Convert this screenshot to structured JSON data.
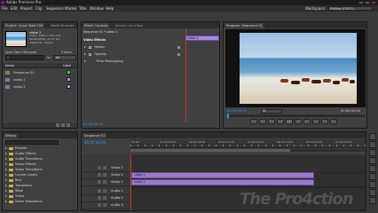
{
  "window": {
    "title": "Adobe Premiere Pro"
  },
  "menu": [
    "File",
    "Edit",
    "Project",
    "Clip",
    "Sequence",
    "Marker",
    "Title",
    "Window",
    "Help"
  ],
  "workspace": {
    "label": "Workspace:",
    "value": "Editing (CS5.5)"
  },
  "project": {
    "tabs": [
      "Project: Quick Take CS6",
      "Media Browser",
      "Info",
      "Effects"
    ],
    "clip_name": "video 2",
    "clip_info": [
      "Video, 1280 x 720 (1.0)",
      "00:00:08:05, 29.97 fps",
      "44100 Hz - Stereo"
    ],
    "project_name": "Quick Take CS6.prproj",
    "items_count": "3 Items",
    "search_placeholder": "",
    "in_label": "In:",
    "in_value": "All",
    "col_name": "Name",
    "col_label": "Label",
    "items": [
      {
        "name": "Sequence 01",
        "color": "#3ec94a"
      },
      {
        "name": "video 1",
        "color": "#a38bd6"
      },
      {
        "name": "video 2",
        "color": "#a38bd6"
      }
    ]
  },
  "effect_controls": {
    "tabs": [
      "Effect Controls",
      "Source: (no clips)"
    ],
    "header": "Sequence 01 * video 1",
    "clip_label": "video 1",
    "section": "Video Effects",
    "effects": [
      "Motion",
      "Opacity",
      "Time Remapping"
    ],
    "timecode": "00:00:00:00"
  },
  "program": {
    "tab": "Program: Sequence 01",
    "timecode_left": "00:00:00:00",
    "timecode_right": "00:00:04:00",
    "fit": "Fit",
    "horses": 8
  },
  "effects": {
    "tabs": [
      "Effects",
      "History"
    ],
    "folders": [
      "Presets",
      "Audio Effects",
      "Audio Transitions",
      "Video Effects",
      "Video Transitions",
      "Lumetri Looks",
      "Blur",
      "Transitions",
      "Wipe",
      "Video",
      "Video Transitions"
    ]
  },
  "timeline": {
    "tab": "Sequence 01",
    "timecode": "00:00:00:00",
    "ruler": [
      "00:00",
      "00:00:04:00",
      "00:00:08:00",
      "00:00:12:00",
      "00:00:16:00",
      "00:00:20:00",
      "00:00:24:00",
      "00:00:28:00"
    ],
    "tracks": [
      {
        "name": "Video 3"
      },
      {
        "name": "Video 2"
      },
      {
        "name": "Video 1"
      },
      {
        "name": "Audio 1"
      },
      {
        "name": "Audio 2"
      },
      {
        "name": "Audio 3"
      }
    ],
    "clips": [
      {
        "name": "video 1"
      },
      {
        "name": "video 2"
      }
    ]
  },
  "watermark": "The Pro4ction"
}
